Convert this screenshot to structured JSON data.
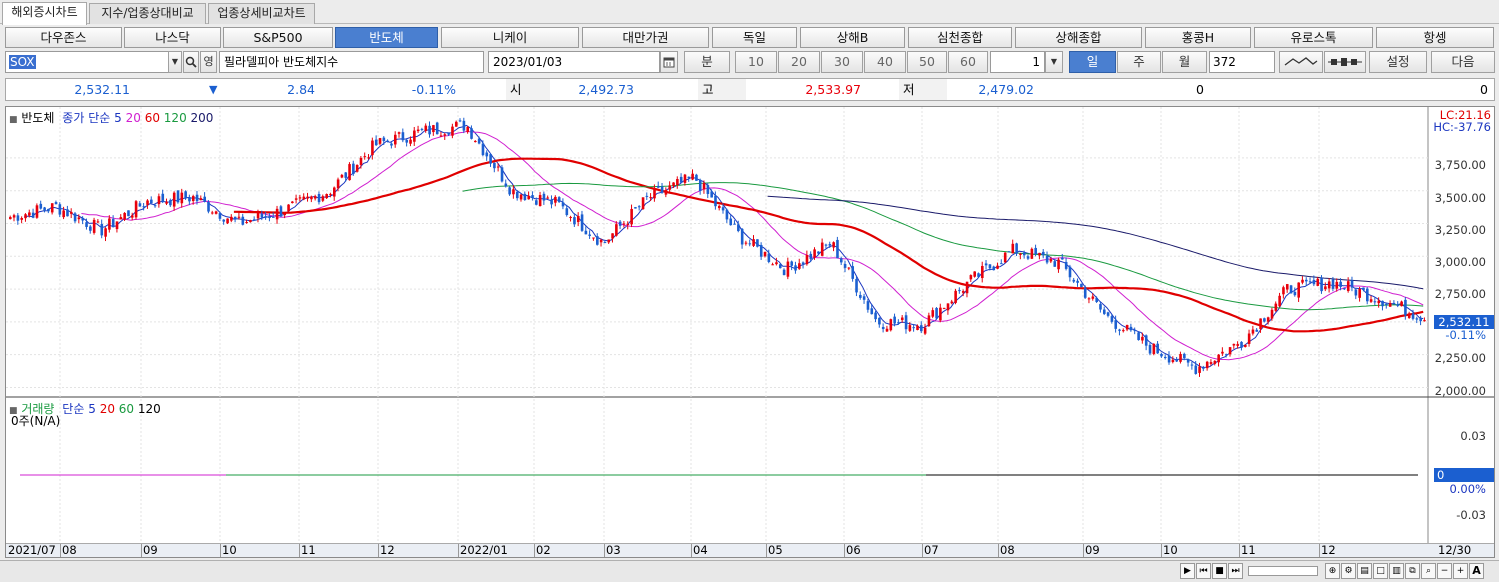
{
  "tabs": [
    "해외증시차트",
    "지수/업종상대비교",
    "업종상세비교차트"
  ],
  "indices": [
    "다우존스",
    "나스닥",
    "S&P500",
    "반도체",
    "니케이",
    "대만가권",
    "독일",
    "상해B",
    "심천종합",
    "상해종합",
    "홍콩H",
    "유로스톡",
    "항셍"
  ],
  "active_index": "반도체",
  "controls": {
    "symbol": "SOX",
    "name": "필라델피아 반도체지수",
    "date": "2023/01/03",
    "interval_label": "분",
    "intervals": [
      "10",
      "20",
      "30",
      "40",
      "50",
      "60"
    ],
    "count_value": "1",
    "period_buttons": [
      "일",
      "주",
      "월"
    ],
    "active_period": "일",
    "bars": "372",
    "settings_label": "설정",
    "next_label": "다음"
  },
  "quote": {
    "price": "2,532.11",
    "change_arrow": "▼",
    "change": "2.84",
    "change_pct": "-0.11%",
    "open_label": "시",
    "open": "2,492.73",
    "high_label": "고",
    "high": "2,533.97",
    "low_label": "저",
    "low": "2,479.02",
    "vol1": "0",
    "vol2": "0"
  },
  "price_panel": {
    "legend_name": "반도체",
    "legend_ma_title": "종가 단순",
    "legend_periods": [
      "5",
      "20",
      "60",
      "120",
      "200"
    ],
    "lc": "LC:21.16",
    "hc": "HC:-37.76",
    "yaxis": [
      "3,750.00",
      "3,500.00",
      "3,250.00",
      "3,000.00",
      "2,750.00",
      "2,500.00",
      "2,250.00",
      "2,000.00"
    ],
    "last_price": "2,532.11",
    "last_pct": "-0.11%"
  },
  "volume_panel": {
    "legend_name": "거래량",
    "legend_ma_title": "단순",
    "legend_periods": [
      "5",
      "20",
      "60",
      "120"
    ],
    "value_text": "0주(N/A)",
    "yaxis": [
      "0.03",
      "0.00%",
      "-0.03"
    ],
    "last_value": "0"
  },
  "xaxis": [
    "2021/07",
    "08",
    "09",
    "10",
    "11",
    "12",
    "2022/01",
    "02",
    "03",
    "04",
    "05",
    "06",
    "07",
    "08",
    "09",
    "10",
    "11",
    "12",
    "12/30"
  ],
  "colors": {
    "up": "#e8000b",
    "down": "#1b5fd0",
    "ma5": "#1b36c0",
    "ma20": "#d020d0",
    "ma60": "#e00000",
    "ma120": "#1a9a40",
    "ma200": "#1a1a6a",
    "accent": "#4a7fd0"
  },
  "chart_data": {
    "type": "candlestick",
    "y_range": [
      1950,
      4100
    ],
    "anchors": [
      [
        "2021/07",
        3300
      ],
      [
        "08",
        3380
      ],
      [
        "08",
        3200
      ],
      [
        "09",
        3420
      ],
      [
        "09",
        3450
      ],
      [
        "10",
        3250
      ],
      [
        "10",
        3350
      ],
      [
        "11",
        3500
      ],
      [
        "11",
        3850
      ],
      [
        "12",
        3950
      ],
      [
        "2022/01",
        4000
      ],
      [
        "01",
        3500
      ],
      [
        "02",
        3400
      ],
      [
        "03",
        3100
      ],
      [
        "03",
        3450
      ],
      [
        "04",
        3600
      ],
      [
        "04",
        3150
      ],
      [
        "05",
        2900
      ],
      [
        "06",
        3100
      ],
      [
        "06",
        2500
      ],
      [
        "07",
        2480
      ],
      [
        "07",
        2800
      ],
      [
        "08",
        3050
      ],
      [
        "08",
        2950
      ],
      [
        "09",
        2550
      ],
      [
        "10",
        2300
      ],
      [
        "10",
        2150
      ],
      [
        "11",
        2350
      ],
      [
        "11",
        2750
      ],
      [
        "12",
        2800
      ],
      [
        "12",
        2680
      ],
      [
        "12/30",
        2532
      ]
    ]
  }
}
